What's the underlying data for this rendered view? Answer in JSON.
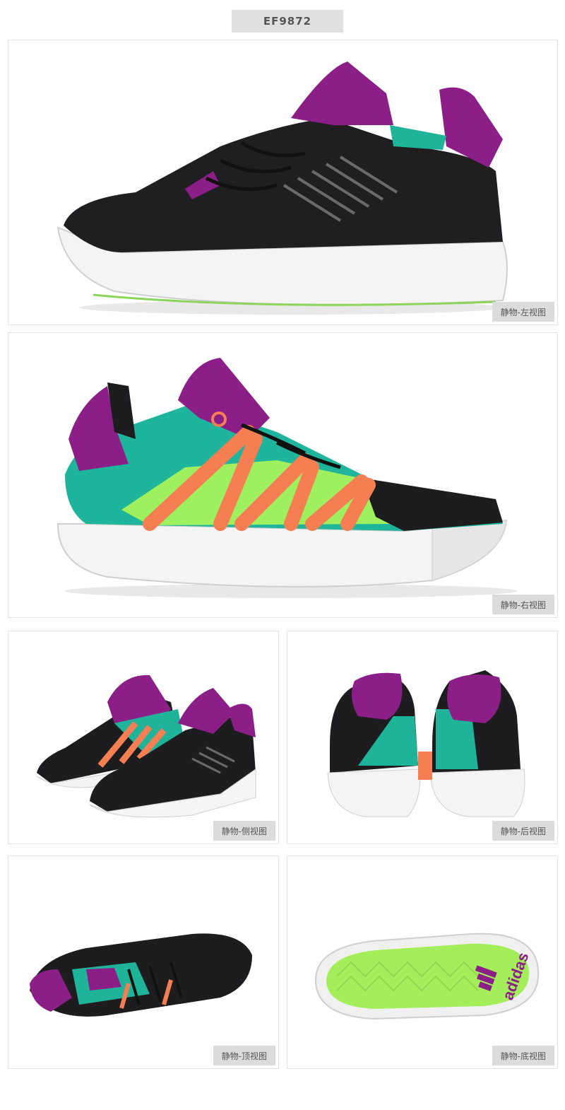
{
  "sku": "EF9872",
  "views": {
    "left": "静物-左视图",
    "right": "静物-右视图",
    "side": "静物-侧视图",
    "back": "静物-后视图",
    "top": "静物-顶视图",
    "bottom": "静物-底视图"
  },
  "sole_brand": "adidas",
  "colors": {
    "black": "#1d1d1f",
    "purple": "#8a1e86",
    "teal": "#1fb39a",
    "lime": "#9bf25a",
    "orange": "#f57e52",
    "white": "#f6f6f6"
  }
}
